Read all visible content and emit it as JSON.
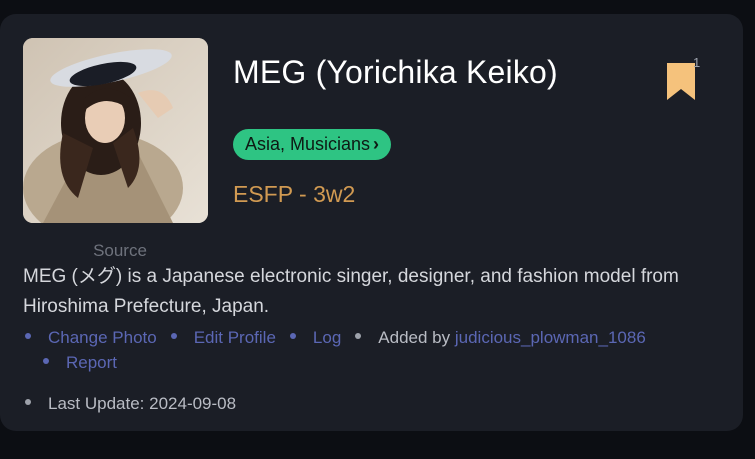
{
  "profile": {
    "name": "MEG (Yorichika Keiko)",
    "category": "Asia, Musicians",
    "type": "ESFP - 3w2",
    "source_label": "Source",
    "bookmark_count": "1",
    "description": "MEG (メグ) is a Japanese electronic singer, designer, and fashion model from Hiroshima Prefecture, Japan."
  },
  "actions": {
    "change_photo": "Change Photo",
    "edit_profile": "Edit Profile",
    "log": "Log",
    "added_by_prefix": "Added by",
    "added_by_user": "judicious_plowman_1086",
    "report": "Report",
    "last_update": "Last Update: 2024-09-08"
  },
  "colors": {
    "background": "#0c0e13",
    "card": "#1b1e26",
    "pill": "#2ec483",
    "type_text": "#d19a52",
    "link": "#5b67b4",
    "bookmark": "#f5c27c"
  },
  "icons": {
    "bookmark": "bookmark-icon",
    "category_arrow": "chevron-right-icon"
  }
}
